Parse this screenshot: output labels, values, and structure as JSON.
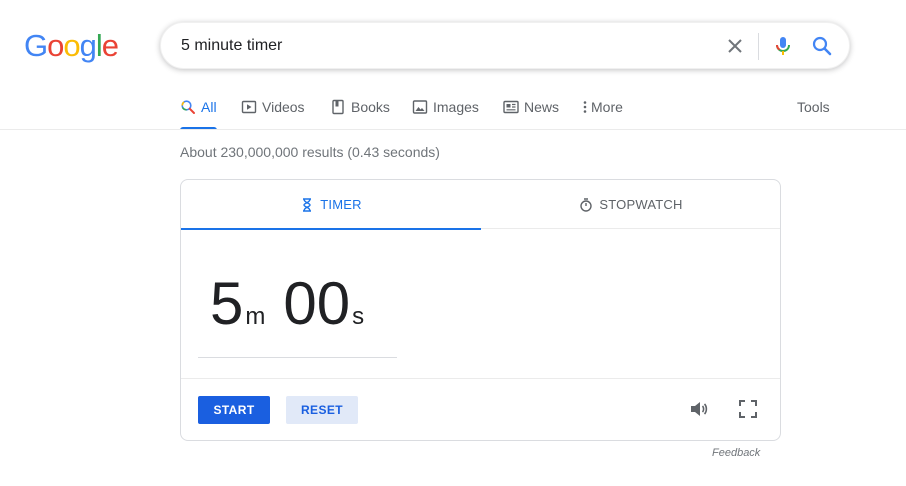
{
  "logo": {
    "letters": [
      "G",
      "o",
      "o",
      "g",
      "l",
      "e"
    ],
    "colors": [
      "#4285F4",
      "#EA4335",
      "#FBBC05",
      "#4285F4",
      "#34A853",
      "#EA4335"
    ]
  },
  "search": {
    "query": "5 minute timer",
    "placeholder": ""
  },
  "tabs": [
    {
      "label": "All",
      "icon": "search-icon",
      "active": true
    },
    {
      "label": "Videos",
      "icon": "video-icon",
      "active": false
    },
    {
      "label": "Books",
      "icon": "book-icon",
      "active": false
    },
    {
      "label": "Images",
      "icon": "image-icon",
      "active": false
    },
    {
      "label": "News",
      "icon": "news-icon",
      "active": false
    },
    {
      "label": "More",
      "icon": "more-vert-icon",
      "active": false
    }
  ],
  "tools_label": "Tools",
  "result_stats": "About 230,000,000 results (0.43 seconds)",
  "widget": {
    "tabs": [
      {
        "label": "TIMER",
        "icon": "hourglass-icon",
        "active": true
      },
      {
        "label": "STOPWATCH",
        "icon": "stopwatch-icon",
        "active": false
      }
    ],
    "minutes": "5",
    "minutes_unit": "m",
    "seconds": "00",
    "seconds_unit": "s",
    "start_label": "START",
    "reset_label": "RESET",
    "sound_icon": "volume-icon",
    "fullscreen_icon": "fullscreen-icon"
  },
  "feedback_label": "Feedback",
  "colors": {
    "accent": "#1a73e8",
    "start_button": "#1a5fe0",
    "reset_button_bg": "#e1e9f8"
  }
}
